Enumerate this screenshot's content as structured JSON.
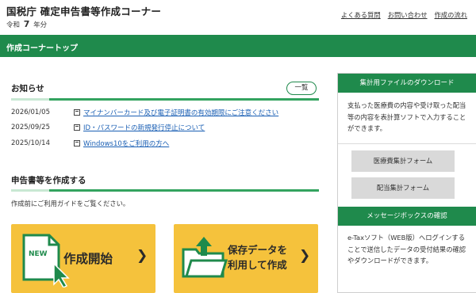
{
  "header": {
    "title": "国税庁 確定申告書等作成コーナー",
    "era_prefix": "令和",
    "era_year": "7",
    "era_suffix": "年分",
    "links": [
      "よくある質問",
      "お問い合わせ",
      "作成の流れ"
    ]
  },
  "nav": {
    "title": "作成コーナートップ"
  },
  "news": {
    "heading": "お知らせ",
    "more_label": "一覧",
    "items": [
      {
        "date": "2026/01/05",
        "text": "マイナンバーカード及び電子証明書の有効期限にご注意ください"
      },
      {
        "date": "2025/09/25",
        "text": "ID・パスワードの新規発行停止について"
      },
      {
        "date": "2025/10/14",
        "text": "Windows10をご利用の方へ"
      }
    ]
  },
  "create": {
    "heading": "申告書等を作成する",
    "guide": "作成前にご利用ガイドをご覧ください。",
    "new_badge": "NEW",
    "start_label": "作成開始",
    "saved_label_line1": "保存データを",
    "saved_label_line2": "利用して作成"
  },
  "sidebar": {
    "download_heading": "集計用ファイルのダウンロード",
    "download_text": "支払った医療費の内容や受け取った配当等の内容を表計算ソフトで入力することができます。",
    "medical_form": "医療費集計フォーム",
    "dividend_form": "配当集計フォーム",
    "message_heading": "メッセージボックスの確認",
    "message_text": "e-Taxソフト（WEB版）へログインすることで送信したデータの受付結果の確認やダウンロードができます。"
  },
  "colors": {
    "brand_green": "#1f8a4c",
    "button_yellow": "#f5c23c",
    "link_blue": "#1a5fb4"
  }
}
